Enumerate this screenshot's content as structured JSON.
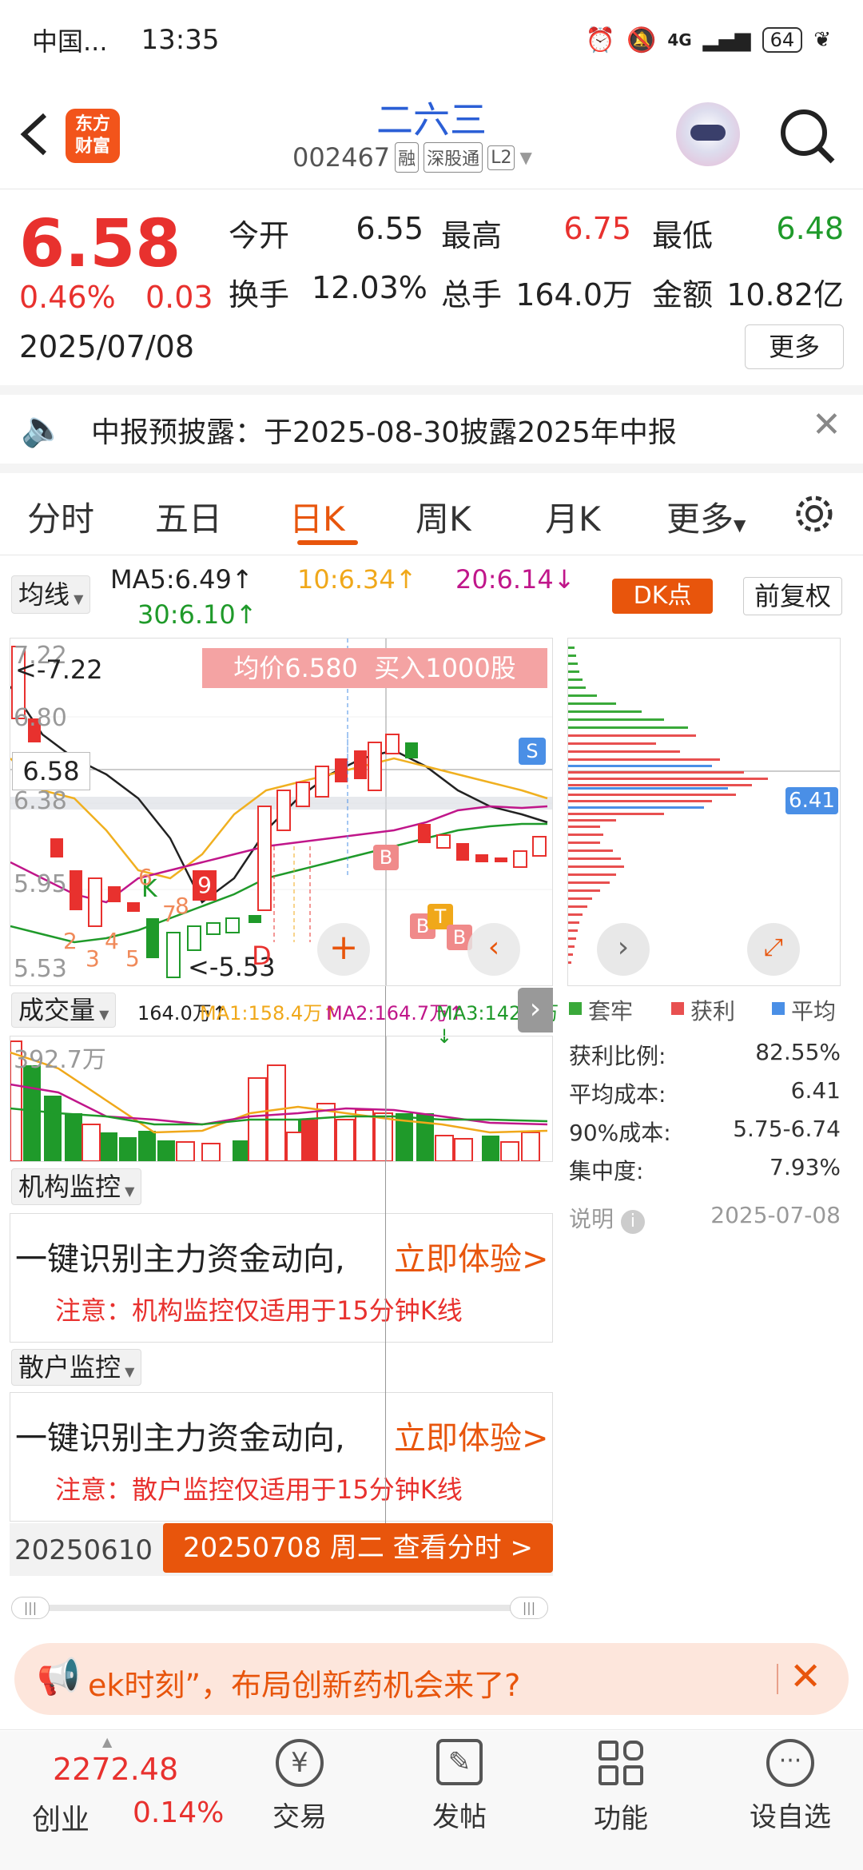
{
  "status_bar": {
    "carrier": "中国...",
    "time": "13:35",
    "network": "4G",
    "battery": "64"
  },
  "header": {
    "logo_line1": "东方",
    "logo_line2": "财富",
    "stock_name": "二六三",
    "stock_code": "002467",
    "badges": [
      "融",
      "深股通",
      "L2"
    ]
  },
  "quote": {
    "price": "6.58",
    "change_pct": "0.46%",
    "change": "0.03",
    "date": "2025/07/08",
    "open_label": "今开",
    "open": "6.55",
    "high_label": "最高",
    "high": "6.75",
    "low_label": "最低",
    "low": "6.48",
    "turnover_label": "换手",
    "turnover": "12.03%",
    "volume_label": "总手",
    "volume": "164.0万",
    "amount_label": "金额",
    "amount": "10.82亿",
    "more": "更多"
  },
  "notice": {
    "text": "中报预披露：于2025-08-30披露2025年中报"
  },
  "tabs": [
    {
      "label": "分时",
      "active": false
    },
    {
      "label": "五日",
      "active": false
    },
    {
      "label": "日K",
      "active": true
    },
    {
      "label": "周K",
      "active": false
    },
    {
      "label": "月K",
      "active": false
    },
    {
      "label": "更多",
      "active": false
    }
  ],
  "ma_bar": {
    "selector": "均线",
    "ma5": "MA5:6.49↑",
    "ma10": "10:6.34↑",
    "ma20": "20:6.14↓",
    "ma30": "30:6.10↑",
    "dk_button": "DK点",
    "adjust_button": "前复权"
  },
  "kline": {
    "y_top": "7.22",
    "y_high_mark": "<-7.22",
    "y_mid1": "6.80",
    "y_cross": "6.58",
    "y_mid2": "6.38",
    "y_mid3": "5.95",
    "y_bottom": "5.53",
    "y_low_mark": "<-5.53",
    "avg_banner": "均价6.580  买入1000股",
    "s_label": "S",
    "marker_b": "B",
    "marker_t": "T",
    "marker_k": "K",
    "marker_d": "D",
    "seq_numbers": [
      "2",
      "3",
      "4",
      "5",
      "6",
      "7",
      "8",
      "9"
    ]
  },
  "volume_bar": {
    "selector": "成交量",
    "vol": "164.0万↑",
    "ma1": "MA1:158.4万↑",
    "ma2": "MA2:164.7万↑",
    "ma3": "MA3:142.0万↓",
    "y_top": "392.7万"
  },
  "chip": {
    "avg_cost_tag": "6.41",
    "legend": [
      "套牢",
      "获利",
      "平均"
    ],
    "profit_ratio_label": "获利比例:",
    "profit_ratio": "82.55%",
    "avg_cost_label": "平均成本:",
    "avg_cost": "6.41",
    "cost90_label": "90%成本:",
    "cost90": "5.75-6.74",
    "concentration_label": "集中度:",
    "concentration": "7.93%",
    "note_label": "说明",
    "note_date": "2025-07-08"
  },
  "institution": {
    "selector": "机构监控",
    "headline": "一键识别主力资金动向,",
    "cta": "立即体验>",
    "note": "注意：机构监控仅适用于15分钟K线"
  },
  "retail": {
    "selector": "散户监控",
    "headline": "一键识别主力资金动向,",
    "cta": "立即体验>",
    "note": "注意：散户监控仅适用于15分钟K线"
  },
  "date_bar": {
    "start": "20250610",
    "current": "20250708 周二 查看分时 >"
  },
  "banner": {
    "text": "ek时刻”，布局创新药机会来了?"
  },
  "bottom_nav": {
    "index_value": "2272.48",
    "index_name": "创业",
    "index_change": "0.14%",
    "items": [
      "交易",
      "发帖",
      "功能",
      "设自选"
    ]
  }
}
